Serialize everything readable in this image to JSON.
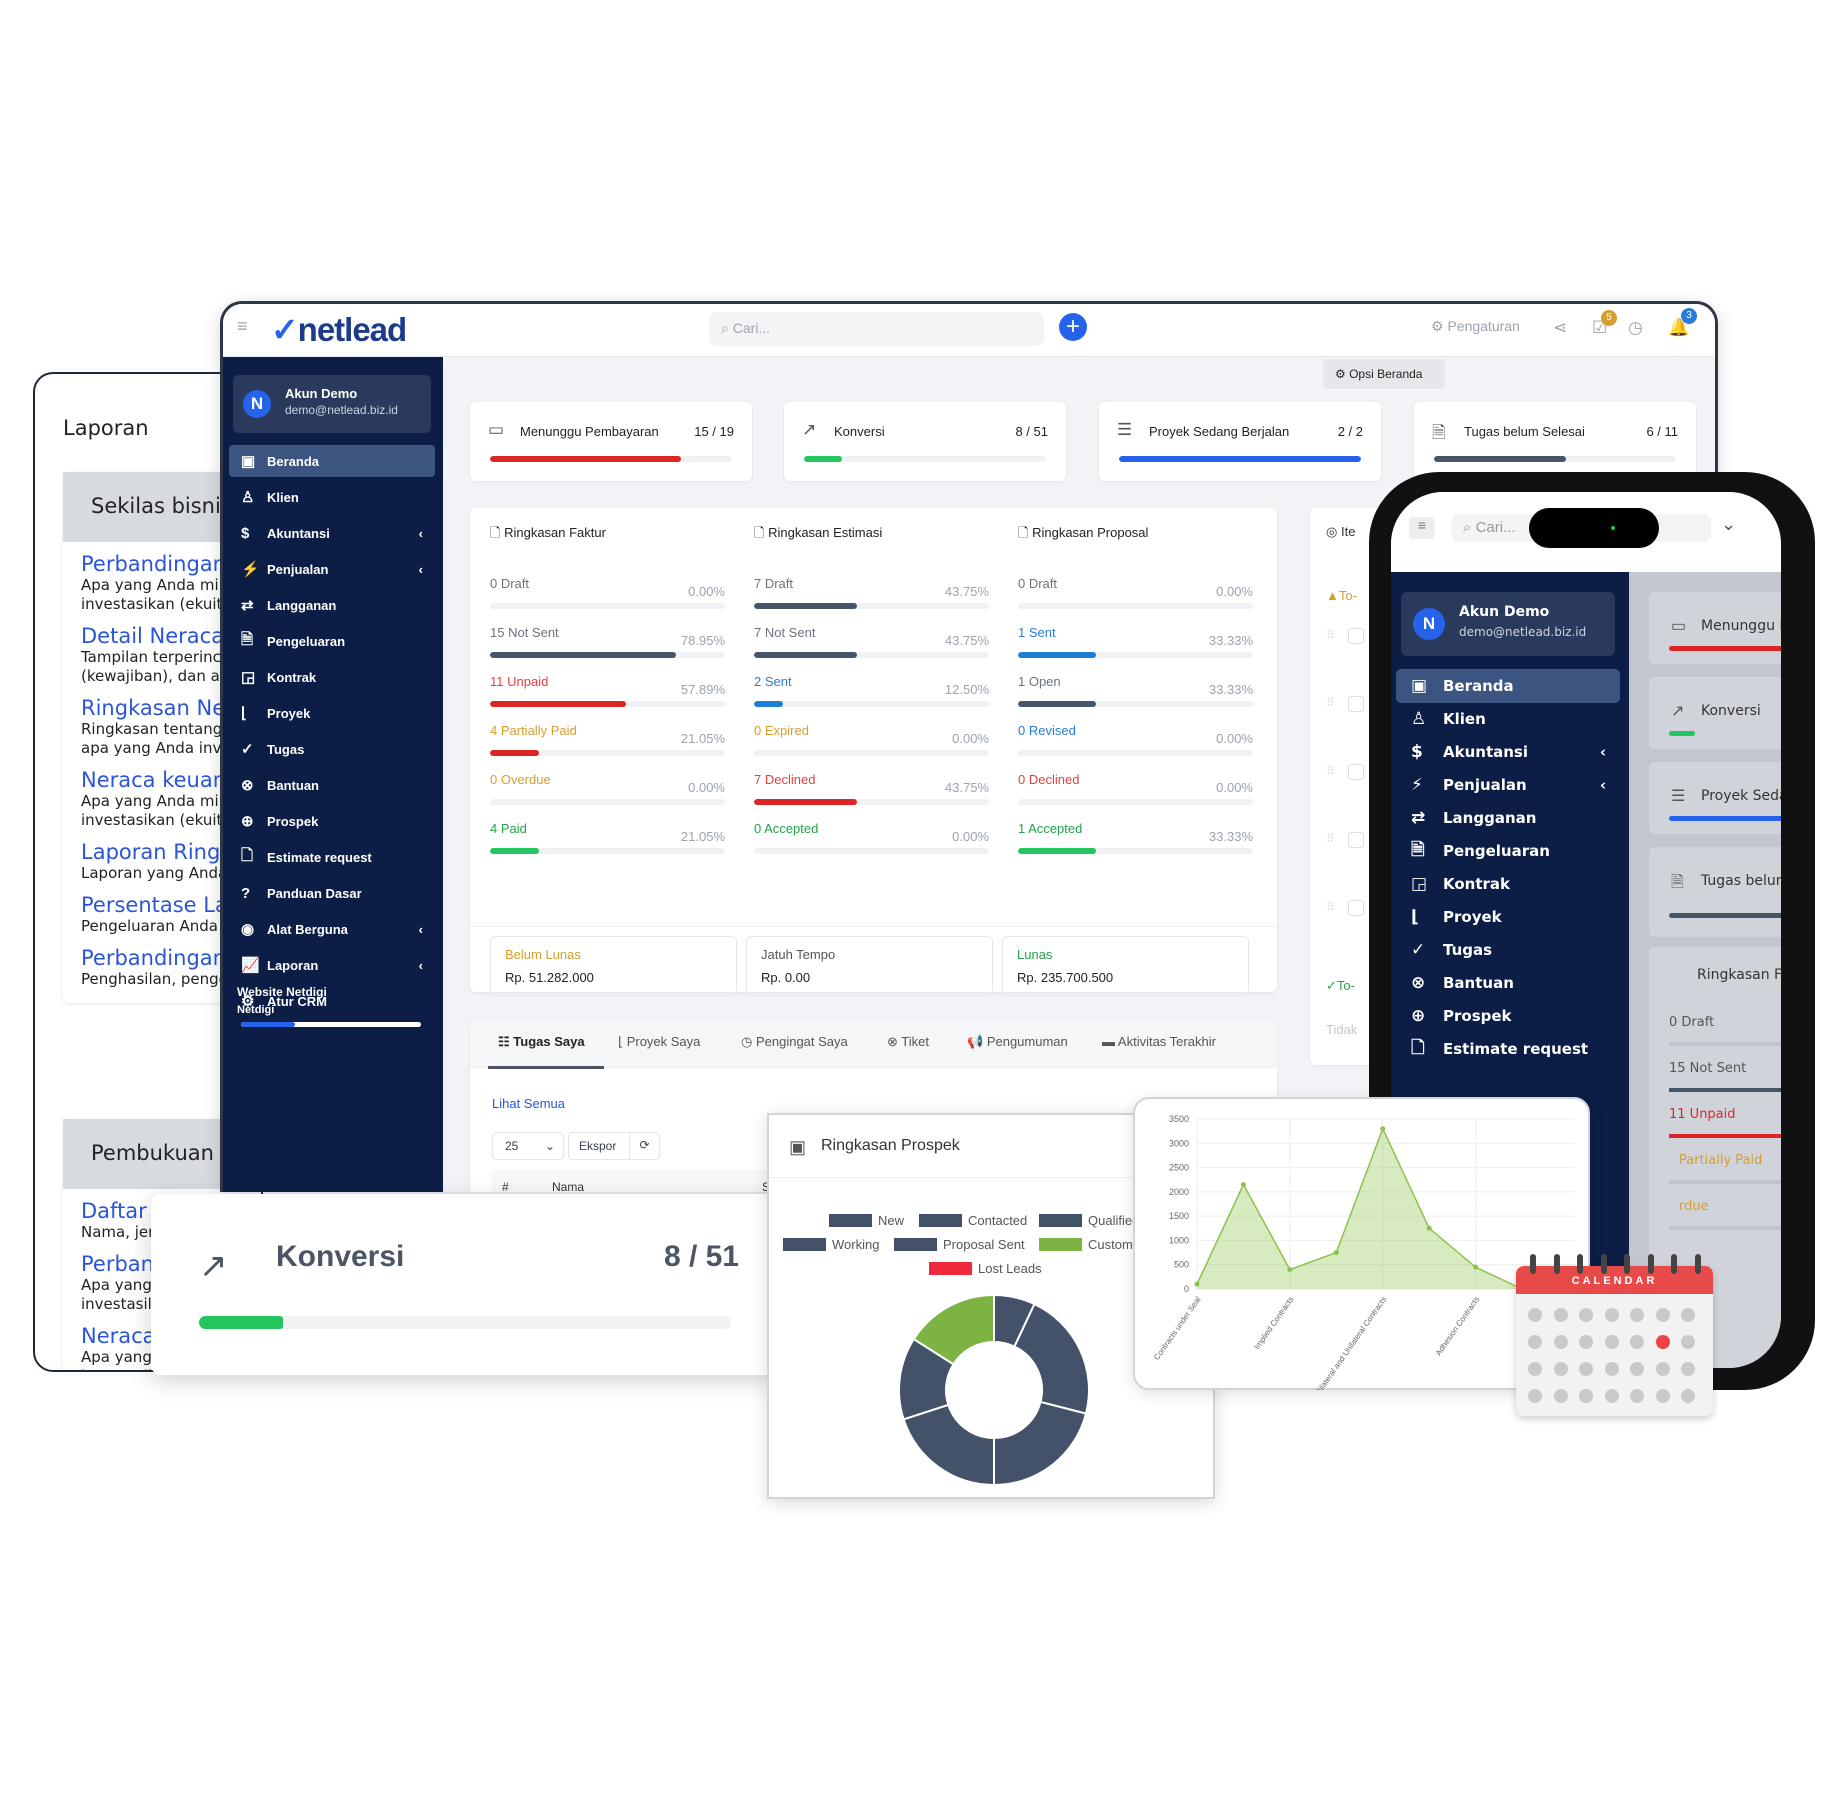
{
  "laporan": {
    "title": "Laporan",
    "sections": [
      {
        "title": "Sekilas bisnis",
        "items": [
          {
            "link": "Perbandingan",
            "desc": [
              "Apa yang Anda mil",
              "investasikan (ekuit"
            ]
          },
          {
            "link": "Detail Neraca",
            "desc": [
              "Tampilan terperinc",
              "(kewajiban), dan ap"
            ]
          },
          {
            "link": "Ringkasan Ner",
            "desc": [
              "Ringkasan tentang",
              "apa yang Anda inv"
            ]
          },
          {
            "link": "Neraca keuang",
            "desc": [
              "Apa yang Anda mil",
              "investasikan (ekuit"
            ]
          },
          {
            "link": "Laporan Ringk",
            "desc": [
              "Laporan yang Anda"
            ]
          },
          {
            "link": "Persentase La",
            "desc": [
              "Pengeluaran Anda"
            ]
          },
          {
            "link": "Perbandingan",
            "desc": [
              "Penghasilan, penge"
            ]
          }
        ]
      },
      {
        "title": "Pembukuan",
        "items": [
          {
            "link": "Daftar akun",
            "desc": [
              "Nama, jer"
            ]
          },
          {
            "link": "Perban",
            "desc": [
              "Apa yang",
              "investasil"
            ]
          },
          {
            "link": "Neraca",
            "desc": [
              "Apa yang",
              "investasil"
            ]
          }
        ]
      }
    ]
  },
  "header": {
    "logo": "netlead",
    "search_placeholder": "Cari...",
    "settings": "Pengaturan",
    "task_badge": "5",
    "notif_badge": "3",
    "home_options": "Opsi Beranda"
  },
  "account": {
    "name": "Akun Demo",
    "email": "demo@netlead.biz.id",
    "initial": "N"
  },
  "sidebar": {
    "items": [
      {
        "label": "Beranda",
        "icon": "dashboard-icon",
        "glyph": "▣",
        "active": true
      },
      {
        "label": "Klien",
        "icon": "user-icon",
        "glyph": "♙"
      },
      {
        "label": "Akuntansi",
        "icon": "dollar-icon",
        "glyph": "$",
        "sub": true
      },
      {
        "label": "Penjualan",
        "icon": "bolt-icon",
        "glyph": "⚡",
        "sub": true
      },
      {
        "label": "Langganan",
        "icon": "repeat-icon",
        "glyph": "⇄"
      },
      {
        "label": "Pengeluaran",
        "icon": "receipt-icon",
        "glyph": "🗎"
      },
      {
        "label": "Kontrak",
        "icon": "contract-icon",
        "glyph": "◲"
      },
      {
        "label": "Proyek",
        "icon": "chart-bar-icon",
        "glyph": "⌊"
      },
      {
        "label": "Tugas",
        "icon": "check-circle-icon",
        "glyph": "✓"
      },
      {
        "label": "Bantuan",
        "icon": "lifebuoy-icon",
        "glyph": "⊗"
      },
      {
        "label": "Prospek",
        "icon": "crosshair-icon",
        "glyph": "⊕"
      },
      {
        "label": "Estimate request",
        "icon": "file-icon",
        "glyph": "🗋"
      },
      {
        "label": "Panduan Dasar",
        "icon": "question-icon",
        "glyph": "?"
      },
      {
        "label": "Alat Berguna",
        "icon": "circle-dot-icon",
        "glyph": "◉",
        "sub": true
      },
      {
        "label": "Laporan",
        "icon": "line-chart-icon",
        "glyph": "📈",
        "sub": true
      },
      {
        "label": "Atur CRM",
        "icon": "gear-icon",
        "glyph": "⚙"
      }
    ],
    "footer": {
      "line1": "Website Netdigi",
      "line2": "Netdigi",
      "progress": 0.3
    }
  },
  "stats": [
    {
      "label": "Menunggu Pembayaran",
      "value": "15 / 19",
      "icon": "money-icon",
      "glyph": "▭",
      "progress": 0.79,
      "color": "#dc2626"
    },
    {
      "label": "Konversi",
      "value": "8 / 51",
      "icon": "trend-up-icon",
      "glyph": "↗",
      "progress": 0.157,
      "color": "#22c55e"
    },
    {
      "label": "Proyek Sedang Berjalan",
      "value": "2 / 2",
      "icon": "sliders-icon",
      "glyph": "☰",
      "progress": 1.0,
      "color": "#2563eb"
    },
    {
      "label": "Tugas belum Selesai",
      "value": "6 / 11",
      "icon": "file-check-icon",
      "glyph": "🗎",
      "progress": 0.545,
      "color": "#475569"
    }
  ],
  "summaries": [
    {
      "title": "Ringkasan Faktur",
      "rows": [
        {
          "label": "0 Draft",
          "pct": "0.00%",
          "v": 0,
          "tc": "#6b7280",
          "bc": "#475569"
        },
        {
          "label": "15 Not Sent",
          "pct": "78.95%",
          "v": 78.95,
          "tc": "#6b7280",
          "bc": "#475569"
        },
        {
          "label": "11 Unpaid",
          "pct": "57.89%",
          "v": 57.89,
          "tc": "#e53e3e",
          "bc": "#dc2626"
        },
        {
          "label": "4 Partially Paid",
          "pct": "21.05%",
          "v": 21.05,
          "tc": "#d69e2e",
          "bc": "#dc2626"
        },
        {
          "label": "0 Overdue",
          "pct": "0.00%",
          "v": 0,
          "tc": "#d69e2e",
          "bc": "#dc2626"
        },
        {
          "label": "4 Paid",
          "pct": "21.05%",
          "v": 21.05,
          "tc": "#22a34a",
          "bc": "#22c55e"
        }
      ]
    },
    {
      "title": "Ringkasan Estimasi",
      "rows": [
        {
          "label": "7 Draft",
          "pct": "43.75%",
          "v": 43.75,
          "tc": "#6b7280",
          "bc": "#475569"
        },
        {
          "label": "7 Not Sent",
          "pct": "43.75%",
          "v": 43.75,
          "tc": "#6b7280",
          "bc": "#475569"
        },
        {
          "label": "2 Sent",
          "pct": "12.50%",
          "v": 12.5,
          "tc": "#2b7bd6",
          "bc": "#1d7ed6"
        },
        {
          "label": "0 Expired",
          "pct": "0.00%",
          "v": 0,
          "tc": "#d69e2e",
          "bc": "#d69e2e"
        },
        {
          "label": "7 Declined",
          "pct": "43.75%",
          "v": 43.75,
          "tc": "#e53e3e",
          "bc": "#dc2626"
        },
        {
          "label": "0 Accepted",
          "pct": "0.00%",
          "v": 0,
          "tc": "#22a34a",
          "bc": "#22c55e"
        }
      ]
    },
    {
      "title": "Ringkasan Proposal",
      "rows": [
        {
          "label": "0 Draft",
          "pct": "0.00%",
          "v": 0,
          "tc": "#6b7280",
          "bc": "#475569"
        },
        {
          "label": "1 Sent",
          "pct": "33.33%",
          "v": 33.33,
          "tc": "#2b7bd6",
          "bc": "#1d7ed6"
        },
        {
          "label": "1 Open",
          "pct": "33.33%",
          "v": 33.33,
          "tc": "#6b7280",
          "bc": "#475569"
        },
        {
          "label": "0 Revised",
          "pct": "0.00%",
          "v": 0,
          "tc": "#2b7bd6",
          "bc": "#1d7ed6"
        },
        {
          "label": "0 Declined",
          "pct": "0.00%",
          "v": 0,
          "tc": "#e53e3e",
          "bc": "#dc2626"
        },
        {
          "label": "1 Accepted",
          "pct": "33.33%",
          "v": 33.33,
          "tc": "#22a34a",
          "bc": "#22c55e"
        }
      ]
    }
  ],
  "totals": [
    {
      "label": "Belum Lunas",
      "value": "Rp. 51.282.000",
      "color": "#d69e2e"
    },
    {
      "label": "Jatuh Tempo",
      "value": "Rp. 0.00",
      "color": "#555555"
    },
    {
      "label": "Lunas",
      "value": "Rp. 235.700.500",
      "color": "#22a34a"
    }
  ],
  "todo": {
    "title": "Ite",
    "pending": "To-",
    "done": "To-",
    "empty": "Tidak"
  },
  "tabs": {
    "items": [
      {
        "label": "Tugas Saya",
        "icon": "list-check-icon",
        "glyph": "☷"
      },
      {
        "label": "Proyek Saya",
        "icon": "chart-bar-icon",
        "glyph": "⌊"
      },
      {
        "label": "Pengingat Saya",
        "icon": "clock-icon",
        "glyph": "◷"
      },
      {
        "label": "Tiket",
        "icon": "lifebuoy-icon",
        "glyph": "⊗"
      },
      {
        "label": "Pengumuman",
        "icon": "megaphone-icon",
        "glyph": "📢"
      },
      {
        "label": "Aktivitas Terakhir",
        "icon": "calendar-icon",
        "glyph": "▬"
      }
    ],
    "view_all": "Lihat Semua",
    "page_size": "25",
    "export": "Ekspor",
    "cols": [
      "#",
      "Nama",
      "S"
    ]
  },
  "konversi_big": {
    "label": "Konversi",
    "value": "8 / 51",
    "progress": 0.157
  },
  "chart_data": [
    {
      "type": "pie",
      "title": "Ringkasan Prospek",
      "donut": true,
      "categories": [
        "New",
        "Contacted",
        "Qualified",
        "Working",
        "Proposal Sent",
        "Customer",
        "Lost Leads"
      ],
      "values": [
        7,
        22,
        21,
        20,
        14,
        16,
        0
      ],
      "colors": [
        "#435268",
        "#435268",
        "#435268",
        "#435268",
        "#435268",
        "#7cb342",
        "#f0283c"
      ],
      "legend": "top"
    },
    {
      "type": "area",
      "categories": [
        "Contracts under Seal",
        "",
        "Implied Contracts",
        "",
        "Bilateral and Unilateral Contracts",
        "",
        "Adhesion Contracts",
        ""
      ],
      "values": [
        100,
        2150,
        400,
        750,
        3300,
        1250,
        450,
        0
      ],
      "ylim": [
        0,
        3500
      ],
      "yticks": [
        0,
        500,
        1000,
        1500,
        2000,
        2500,
        3000,
        3500
      ],
      "grid": true,
      "color": "#8bc34a"
    }
  ],
  "calendar": {
    "label": "CALENDAR",
    "highlight_color": "#ef4444"
  },
  "phone": {
    "search_placeholder": "Cari...",
    "cards": [
      "Menunggu P",
      "Konversi",
      "Proyek Seda",
      "Tugas belum"
    ],
    "summary_title": "Ringkasan Fa",
    "rows": [
      "0 Draft",
      "15 Not Sent",
      "11 Unpaid",
      "Partially Paid",
      "rdue"
    ]
  }
}
